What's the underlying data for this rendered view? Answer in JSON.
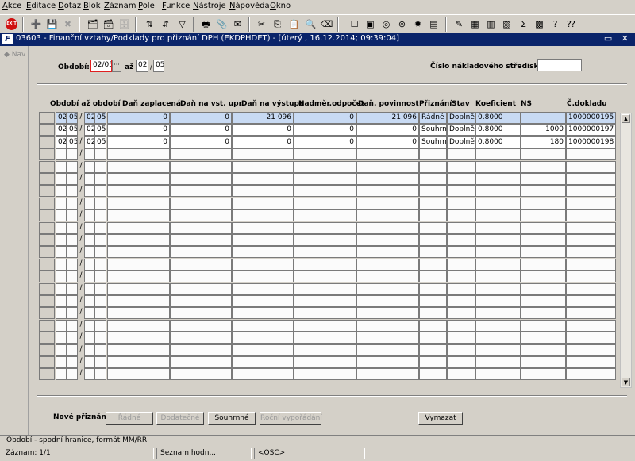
{
  "menu": [
    "Akce",
    "Editace",
    "Dotaz",
    "Blok",
    "Záznam",
    "Pole",
    "Funkce",
    "Nástroje",
    "Nápověda",
    "Okno"
  ],
  "toolbar": {
    "exit_label": "EXIT",
    "icons": [
      "exit-icon",
      "insert-icon",
      "save-icon",
      "delete-icon",
      "enter-query-icon",
      "execute-query-icon",
      "cancel-query-icon",
      "sort-asc-icon",
      "sort-desc-icon",
      "filter-icon",
      "print-icon",
      "attach-icon",
      "mail-icon",
      "cut-icon",
      "copy-icon",
      "paste-icon",
      "find-icon",
      "clear-icon",
      "first-record-icon",
      "globe-icon",
      "settings-icon",
      "notes-icon",
      "edit-icon",
      "excel-icon",
      "sum-icon",
      "calculator-icon",
      "help-icon",
      "context-help-icon"
    ]
  },
  "window": {
    "title": "03603 - Finanční vztahy/Podklady pro přiznání DPH (EKDPHDET) - [úterý  , 16.12.2014; 09:39:04]",
    "app_icon": "F",
    "controls": "▭ ✕"
  },
  "nav": {
    "label": "Nav"
  },
  "filter": {
    "period_label": "Období:",
    "period_from": "02/05",
    "lov": "···",
    "to_label": "až",
    "period_to_month": "02",
    "period_to_year": "05",
    "slash": "/",
    "cost_center_label": "Číslo nákladového střediska",
    "cost_center_value": ""
  },
  "columns": {
    "period_to": "Období až období",
    "paid_tax": "Daň zaplacená",
    "input_tax": "Daň na vst. upr.",
    "output_tax": "Daň na výstupu",
    "excess_deduction": "Nadměr.odpočet",
    "tax_liability": "Daň. povinnost",
    "return_type": "Přiznání",
    "state": "Stav",
    "coefficient": "Koeficient",
    "ns": "NS",
    "doc_no": "Č.dokladu"
  },
  "rows": [
    {
      "from_m": "02",
      "from_y": "05",
      "to_m": "02",
      "to_y": "05",
      "paid": "0",
      "input": "0",
      "output": "21 096",
      "excess": "0",
      "liability": "21 096",
      "type": "Řádné",
      "state": "Doplněn",
      "coef": "0.8000",
      "ns": "",
      "doc": "1000000195"
    },
    {
      "from_m": "02",
      "from_y": "05",
      "to_m": "02",
      "to_y": "05",
      "paid": "0",
      "input": "0",
      "output": "0",
      "excess": "0",
      "liability": "0",
      "type": "Souhrnn",
      "state": "Doplněn",
      "coef": "0.8000",
      "ns": "1000",
      "doc": "1000000197"
    },
    {
      "from_m": "02",
      "from_y": "05",
      "to_m": "02",
      "to_y": "05",
      "paid": "0",
      "input": "0",
      "output": "0",
      "excess": "0",
      "liability": "0",
      "type": "Souhrnn",
      "state": "Doplněn",
      "coef": "0.8000",
      "ns": "180",
      "doc": "1000000198"
    }
  ],
  "buttons": {
    "new_return_label": "Nové přiznání",
    "regular": "Řádné",
    "supplementary": "Dodatečné",
    "summary": "Souhrnné",
    "annual": "Roční vypořádání",
    "delete": "Vymazat"
  },
  "status": {
    "hint": "Období - spodní hranice, formát MM/RR",
    "record": "Záznam: 1/1",
    "list": "Seznam hodn...",
    "mode": "<OSC>"
  }
}
